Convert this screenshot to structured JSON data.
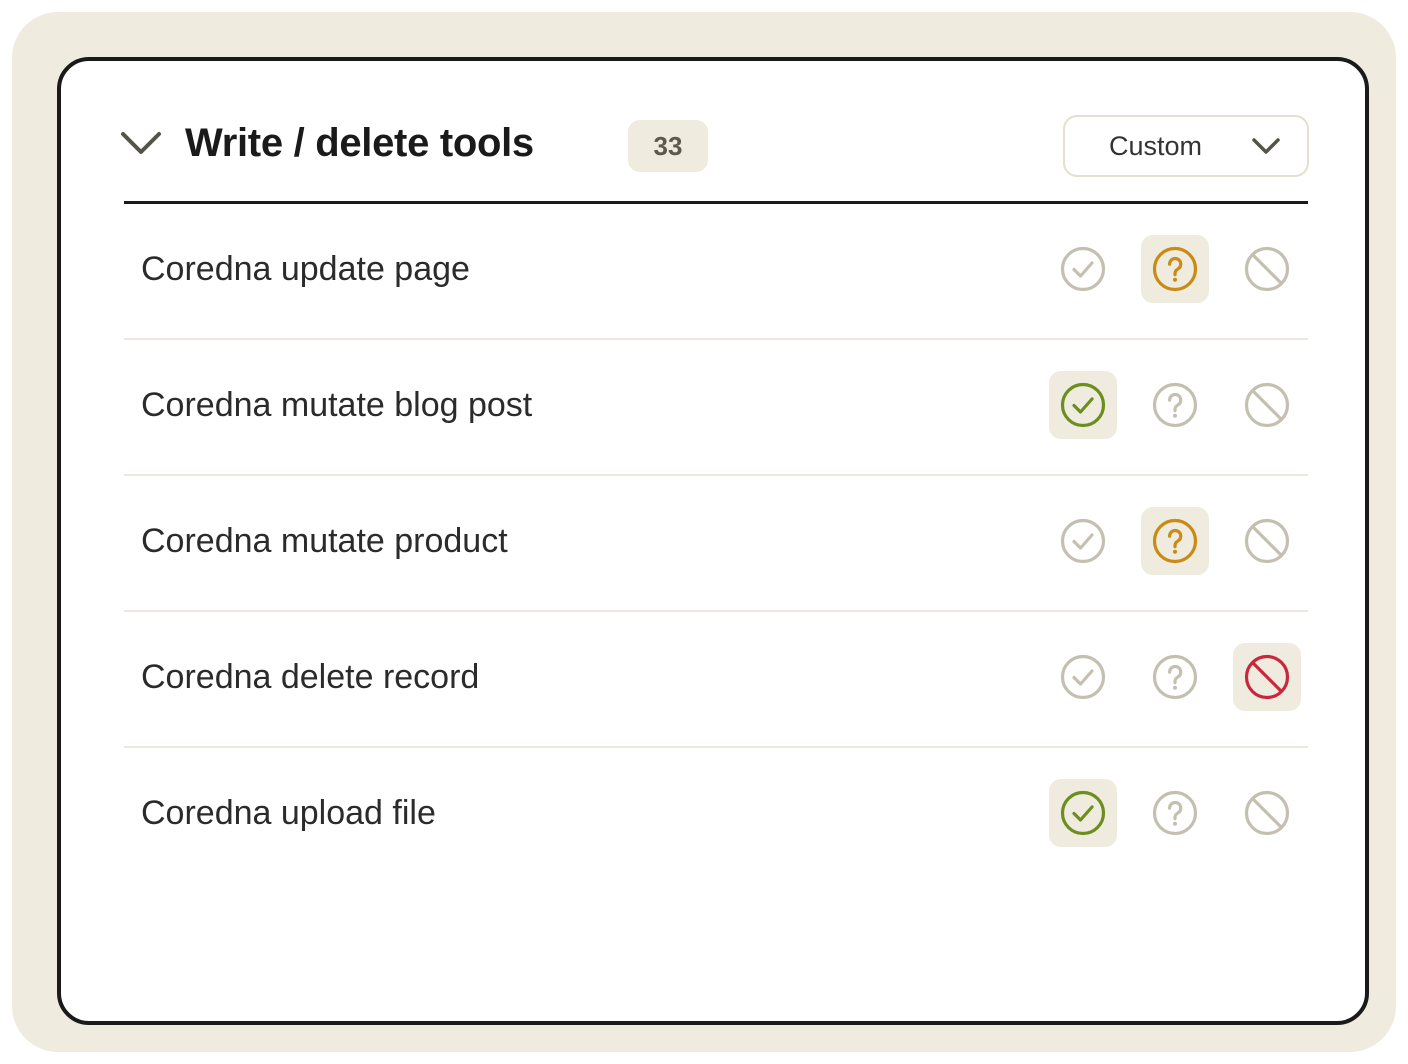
{
  "section": {
    "title": "Write / delete tools",
    "count": "33",
    "mode_select": {
      "value": "Custom"
    }
  },
  "colors": {
    "allow": "#6b8e1f",
    "ask": "#c98a16",
    "deny": "#c8283c",
    "inactive": "#c4c0b0",
    "selected_bg": "#efebde"
  },
  "tools": [
    {
      "name": "Coredna update page",
      "permission": "ask"
    },
    {
      "name": "Coredna mutate blog post",
      "permission": "allow"
    },
    {
      "name": "Coredna mutate product",
      "permission": "ask"
    },
    {
      "name": "Coredna delete record",
      "permission": "deny"
    },
    {
      "name": "Coredna upload file",
      "permission": "allow"
    }
  ]
}
